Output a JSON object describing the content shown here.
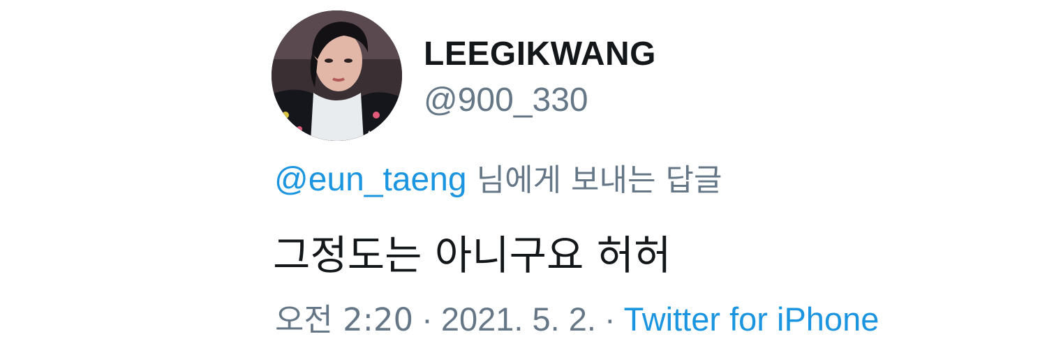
{
  "author": {
    "display_name": "LEEGIKWANG",
    "handle": "@900_330",
    "avatar_icon": "profile-photo"
  },
  "reply_context": {
    "to_handle": "@eun_taeng",
    "suffix": "님에게 보내는 답글"
  },
  "tweet": {
    "text": "그정도는 아니구요 허허"
  },
  "meta": {
    "time": "오전 2:20",
    "separator": "·",
    "date": "2021. 5. 2.",
    "source": "Twitter for iPhone"
  },
  "colors": {
    "text_primary": "#14171a",
    "text_secondary": "#657786",
    "link": "#1b95e0",
    "background": "#ffffff"
  }
}
